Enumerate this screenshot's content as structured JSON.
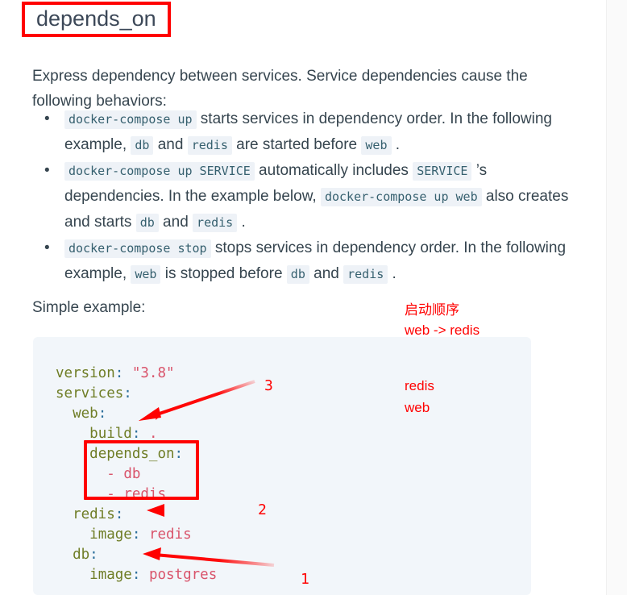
{
  "page": {
    "heading": "depends_on",
    "intro": "Express dependency between services. Service dependencies cause the following behaviors:",
    "example_label": "Simple example:"
  },
  "behaviors": [
    {
      "segments": [
        {
          "type": "code",
          "text": "docker-compose up"
        },
        {
          "type": "text",
          "text": " starts services in dependency order. In the following example, "
        },
        {
          "type": "code",
          "text": "db"
        },
        {
          "type": "text",
          "text": " and "
        },
        {
          "type": "code",
          "text": "redis"
        },
        {
          "type": "text",
          "text": " are started before "
        },
        {
          "type": "code",
          "text": "web"
        },
        {
          "type": "text",
          "text": " ."
        }
      ]
    },
    {
      "segments": [
        {
          "type": "code",
          "text": "docker-compose up SERVICE"
        },
        {
          "type": "text",
          "text": " automatically includes "
        },
        {
          "type": "code",
          "text": "SERVICE"
        },
        {
          "type": "text",
          "text": " ’s dependencies. In the example below, "
        },
        {
          "type": "code",
          "text": "docker-compose up web"
        },
        {
          "type": "text",
          "text": " also creates and starts "
        },
        {
          "type": "code",
          "text": "db"
        },
        {
          "type": "text",
          "text": " and "
        },
        {
          "type": "code",
          "text": "redis"
        },
        {
          "type": "text",
          "text": " ."
        }
      ]
    },
    {
      "segments": [
        {
          "type": "code",
          "text": "docker-compose stop"
        },
        {
          "type": "text",
          "text": " stops services in dependency order. In the following example, "
        },
        {
          "type": "code",
          "text": "web"
        },
        {
          "type": "text",
          "text": " is stopped before "
        },
        {
          "type": "code",
          "text": "db"
        },
        {
          "type": "text",
          "text": " and "
        },
        {
          "type": "code",
          "text": "redis"
        },
        {
          "type": "text",
          "text": " ."
        }
      ]
    }
  ],
  "code_block": {
    "language": "yaml",
    "lines": [
      [
        {
          "c": "k",
          "t": "version"
        },
        {
          "c": "p",
          "t": ":"
        },
        {
          "c": "plain",
          "t": " "
        },
        {
          "c": "s",
          "t": "\"3.8\""
        }
      ],
      [
        {
          "c": "k",
          "t": "services"
        },
        {
          "c": "p",
          "t": ":"
        }
      ],
      [
        {
          "c": "plain",
          "t": "  "
        },
        {
          "c": "k",
          "t": "web"
        },
        {
          "c": "p",
          "t": ":"
        }
      ],
      [
        {
          "c": "plain",
          "t": "    "
        },
        {
          "c": "k",
          "t": "build"
        },
        {
          "c": "p",
          "t": ":"
        },
        {
          "c": "plain",
          "t": " "
        },
        {
          "c": "s",
          "t": "."
        }
      ],
      [
        {
          "c": "plain",
          "t": "    "
        },
        {
          "c": "k",
          "t": "depends_on"
        },
        {
          "c": "p",
          "t": ":"
        }
      ],
      [
        {
          "c": "plain",
          "t": "      "
        },
        {
          "c": "d",
          "t": "-"
        },
        {
          "c": "plain",
          "t": " "
        },
        {
          "c": "s",
          "t": "db"
        }
      ],
      [
        {
          "c": "plain",
          "t": "      "
        },
        {
          "c": "d",
          "t": "-"
        },
        {
          "c": "plain",
          "t": " "
        },
        {
          "c": "s",
          "t": "redis"
        }
      ],
      [
        {
          "c": "plain",
          "t": "  "
        },
        {
          "c": "k",
          "t": "redis"
        },
        {
          "c": "p",
          "t": ":"
        }
      ],
      [
        {
          "c": "plain",
          "t": "    "
        },
        {
          "c": "k",
          "t": "image"
        },
        {
          "c": "p",
          "t": ":"
        },
        {
          "c": "plain",
          "t": " "
        },
        {
          "c": "s",
          "t": "redis"
        }
      ],
      [
        {
          "c": "plain",
          "t": "  "
        },
        {
          "c": "k",
          "t": "db"
        },
        {
          "c": "p",
          "t": ":"
        }
      ],
      [
        {
          "c": "plain",
          "t": "    "
        },
        {
          "c": "k",
          "t": "image"
        },
        {
          "c": "p",
          "t": ":"
        },
        {
          "c": "plain",
          "t": " "
        },
        {
          "c": "s",
          "t": "postgres"
        }
      ]
    ]
  },
  "annotations": {
    "color": "#ff0000",
    "startup_order_title": "启动顺序",
    "startup_order_value": "web -> redis",
    "service_list": [
      "redis",
      "web"
    ],
    "step_numbers": [
      "3",
      "2",
      "1"
    ],
    "highlight_boxes": [
      "heading-depends_on",
      "code-depends_on-block"
    ]
  }
}
